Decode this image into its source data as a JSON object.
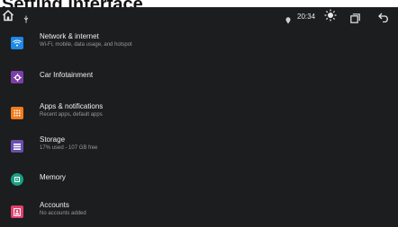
{
  "page_title": "Setting interface",
  "status_bar": {
    "time": "20:34",
    "icons": [
      "home-icon",
      "usb-icon",
      "location-icon",
      "brightness-icon",
      "recent-apps-icon",
      "back-icon"
    ]
  },
  "settings": [
    {
      "title": "Network & internet",
      "subtitle": "Wi-Fi, mobile, data usage, and hotspot",
      "icon": "wifi-icon",
      "color": "#1e88e5"
    },
    {
      "title": "Car Infotainment",
      "subtitle": "",
      "icon": "gear-icon",
      "color": "#7b3fa8"
    },
    {
      "title": "Apps & notifications",
      "subtitle": "Recent apps, default apps",
      "icon": "apps-icon",
      "color": "#f07b1d"
    },
    {
      "title": "Storage",
      "subtitle": "17% used - 107 GB free",
      "icon": "storage-icon",
      "color": "#6a4fb0"
    },
    {
      "title": "Memory",
      "subtitle": "",
      "icon": "memory-icon",
      "color": "#1a9f84"
    },
    {
      "title": "Accounts",
      "subtitle": "No accounts added",
      "icon": "account-icon",
      "color": "#e0426e"
    }
  ]
}
